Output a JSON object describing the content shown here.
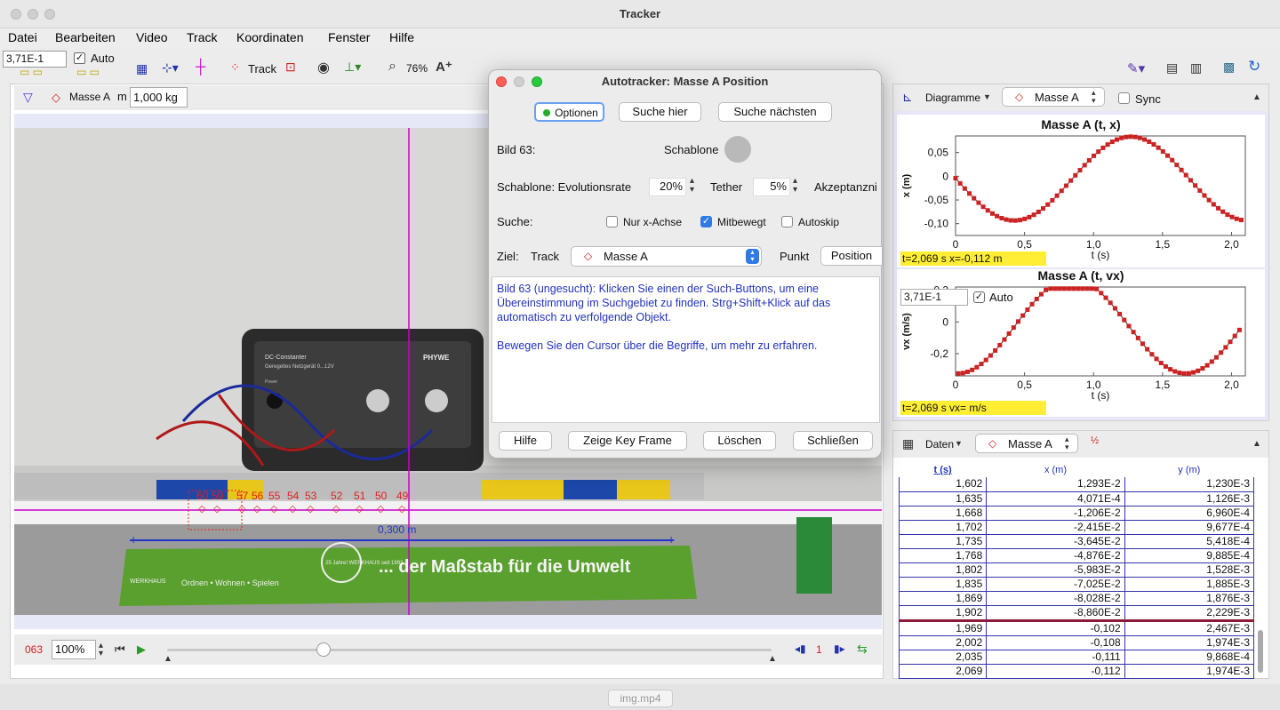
{
  "window": {
    "title": "Tracker"
  },
  "menu": [
    "Datei",
    "Bearbeiten",
    "Video",
    "Track",
    "Koordinaten",
    "Fenster",
    "Hilfe"
  ],
  "toolbar": {
    "step_value": "3,71E-1",
    "auto_label": "Auto",
    "track_label": "Track",
    "zoom": "76%"
  },
  "track_bar": {
    "track_name": "Masse A",
    "mass_label": "m",
    "mass_value": "1,000 kg"
  },
  "video": {
    "scale_label": "0,300 m",
    "frame_labels": [
      "60",
      "59",
      "57",
      "56",
      "55",
      "54",
      "53",
      "52",
      "51",
      "50",
      "49"
    ],
    "ruler_text": "... der Maßstab für die Umwelt",
    "ruler_sub": "Ordnen • Wohnen • Spielen",
    "ruler_badge": "25 Jahre! WERKHAUS seit 1992",
    "ruler_brand": "WERKHAUS",
    "device_title": "DC-Constanter",
    "device_subtitle": "Geregeltes Netzgerät 0...12V",
    "device_power": "Power",
    "device_brand": "PHYWE"
  },
  "player": {
    "frame": "063",
    "rate": "100%",
    "step": "1"
  },
  "dialog": {
    "title": "Autotracker: Masse A Position",
    "buttons_top": [
      "Optionen",
      "Suche hier",
      "Suche nächsten"
    ],
    "frame_label": "Bild 63:",
    "template_label": "Schablone",
    "template_row_label": "Schablone: Evolutionsrate",
    "evolution_rate": "20%",
    "tether_label": "Tether",
    "tether_value": "5%",
    "acceptance_label": "Akzeptanzni",
    "search_label": "Suche:",
    "opt_x_only": "Nur x-Achse",
    "opt_follow": "Mitbewegt",
    "opt_autoskip": "Autoskip",
    "target_label": "Ziel:",
    "track_label": "Track",
    "track_value": "Masse A",
    "point_label": "Punkt",
    "point_value": "Position",
    "info_line1": "Bild 63 (ungesucht): Klicken Sie einen der Such-Buttons, um eine Übereinstimmung im Suchgebiet zu finden. Strg+Shift+Klick auf das automatisch zu verfolgende Objekt.",
    "info_line2": "Bewegen Sie den Cursor über die Begriffe, um mehr zu erfahren.",
    "buttons_bottom": [
      "Hilfe",
      "Zeige Key Frame",
      "Löschen",
      "Schließen"
    ]
  },
  "charts_panel": {
    "view": "Diagramme",
    "track": "Masse A",
    "sync_label": "Sync",
    "step_value": "3,71E-1",
    "auto_label": "Auto"
  },
  "chart_data": [
    {
      "type": "scatter",
      "title": "Masse A (t, x)",
      "xlabel": "t (s)",
      "ylabel": "x (m)",
      "xlim": [
        0,
        2.1
      ],
      "ylim": [
        -0.125,
        0.085
      ],
      "xticks": [
        "0",
        "0,5",
        "1,0",
        "1,5",
        "2,0"
      ],
      "yticks": [
        "0,05",
        "0",
        "-0,05",
        "-0,10"
      ],
      "readout": "t=2,069 s  x=-0,112 m",
      "color": "#cc2222"
    },
    {
      "type": "scatter",
      "title": "Masse A (t, vx)",
      "xlabel": "t (s)",
      "ylabel": "vx (m/s)",
      "xlim": [
        0,
        2.1
      ],
      "ylim": [
        -0.34,
        0.22
      ],
      "xticks": [
        "0",
        "0,5",
        "1,0",
        "1,5",
        "2,0"
      ],
      "yticks": [
        "0,2",
        "0",
        "-0,2"
      ],
      "readout": "t=2,069 s  vx= m/s",
      "color": "#cc2222"
    }
  ],
  "table_panel": {
    "view": "Daten",
    "track": "Masse A",
    "columns": [
      "t (s)",
      "x (m)",
      "y (m)"
    ],
    "rows": [
      [
        "1,602",
        "1,293E-2",
        "1,230E-3"
      ],
      [
        "1,635",
        "4,071E-4",
        "1,126E-3"
      ],
      [
        "1,668",
        "-1,206E-2",
        "6,960E-4"
      ],
      [
        "1,702",
        "-2,415E-2",
        "9,677E-4"
      ],
      [
        "1,735",
        "-3,645E-2",
        "5,418E-4"
      ],
      [
        "1,768",
        "-4,876E-2",
        "9,885E-4"
      ],
      [
        "1,802",
        "-5,983E-2",
        "1,528E-3"
      ],
      [
        "1,835",
        "-7,025E-2",
        "1,885E-3"
      ],
      [
        "1,869",
        "-8,028E-2",
        "1,876E-3"
      ],
      [
        "1,902",
        "-8,860E-2",
        "2,229E-3"
      ],
      [
        "1,969",
        "-0,102",
        "2,467E-3"
      ],
      [
        "2,002",
        "-0,108",
        "1,974E-3"
      ],
      [
        "2,035",
        "-0,111",
        "9,868E-4"
      ],
      [
        "2,069",
        "-0,112",
        "1,974E-3"
      ]
    ]
  },
  "status": {
    "file": "img.mp4"
  }
}
